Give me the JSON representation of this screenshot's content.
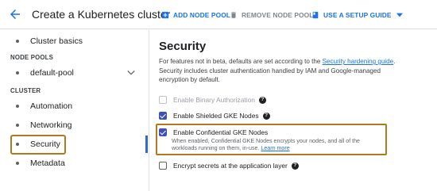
{
  "header": {
    "title": "Create a Kubernetes cluster",
    "add_node_pool": "ADD NODE POOL",
    "remove_node_pool": "REMOVE NODE POOL",
    "setup_guide": "USE A SETUP GUIDE"
  },
  "sidebar": {
    "cluster_basics": "Cluster basics",
    "node_pools_header": "NODE POOLS",
    "default_pool": "default-pool",
    "cluster_header": "CLUSTER",
    "automation": "Automation",
    "networking": "Networking",
    "security": "Security",
    "metadata": "Metadata"
  },
  "main": {
    "heading": "Security",
    "desc_prefix": "For features not in beta, defaults are set according to the ",
    "desc_link": "Security hardening guide",
    "desc_suffix": ". Security includes cluster authentication handled by IAM and Google-managed encryption by default.",
    "options": {
      "binary_auth": "Enable Binary Authorization",
      "shielded_nodes": "Enable Shielded GKE Nodes",
      "confidential_nodes": "Enable Confidential GKE Nodes",
      "confidential_desc": "When enabled, Confidential GKE Nodes encrypts your nodes, and all of the workloads running on them, in-use.",
      "learn_more": "Learn more",
      "encrypt_secrets": "Encrypt secrets at the application layer"
    }
  },
  "colors": {
    "accent": "#1a73e8",
    "highlight_border": "#b07a1c",
    "checkbox_checked": "#3f51b5"
  },
  "icons": {
    "back": "arrow-left-icon",
    "add": "add-box-icon",
    "remove": "trash-icon",
    "guide": "book-icon",
    "help": "help-circle-icon"
  }
}
